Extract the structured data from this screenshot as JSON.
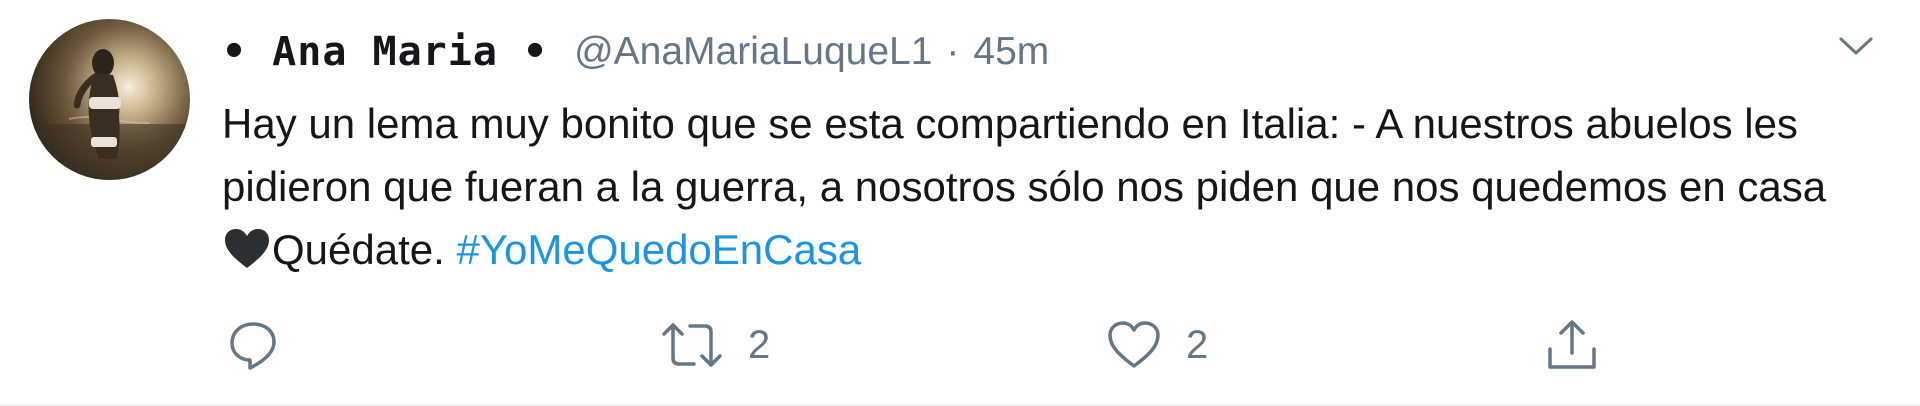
{
  "tweet": {
    "display_name": "• Ana Maria •",
    "handle": "@AnaMariaLuqueL1",
    "separator": "·",
    "time": "45m",
    "text_before_heart": "Hay un lema muy bonito que se esta compartiendo en Italia: - A nuestros abuelos les pidieron que fueran a la guerra, a nosotros sólo nos piden que nos quedemos en casa",
    "text_after_heart": "Quédate. ",
    "hashtag": "#YoMeQuedoEnCasa"
  },
  "actions": {
    "reply_count": "",
    "retweet_count": "2",
    "like_count": "2"
  },
  "colors": {
    "text": "#14171a",
    "secondary": "#657786",
    "link": "#1b95e0",
    "heart_emoji": "#292f33"
  },
  "icons": [
    "more-caret-icon",
    "reply-icon",
    "retweet-icon",
    "like-icon",
    "share-icon",
    "black-heart-emoji"
  ]
}
